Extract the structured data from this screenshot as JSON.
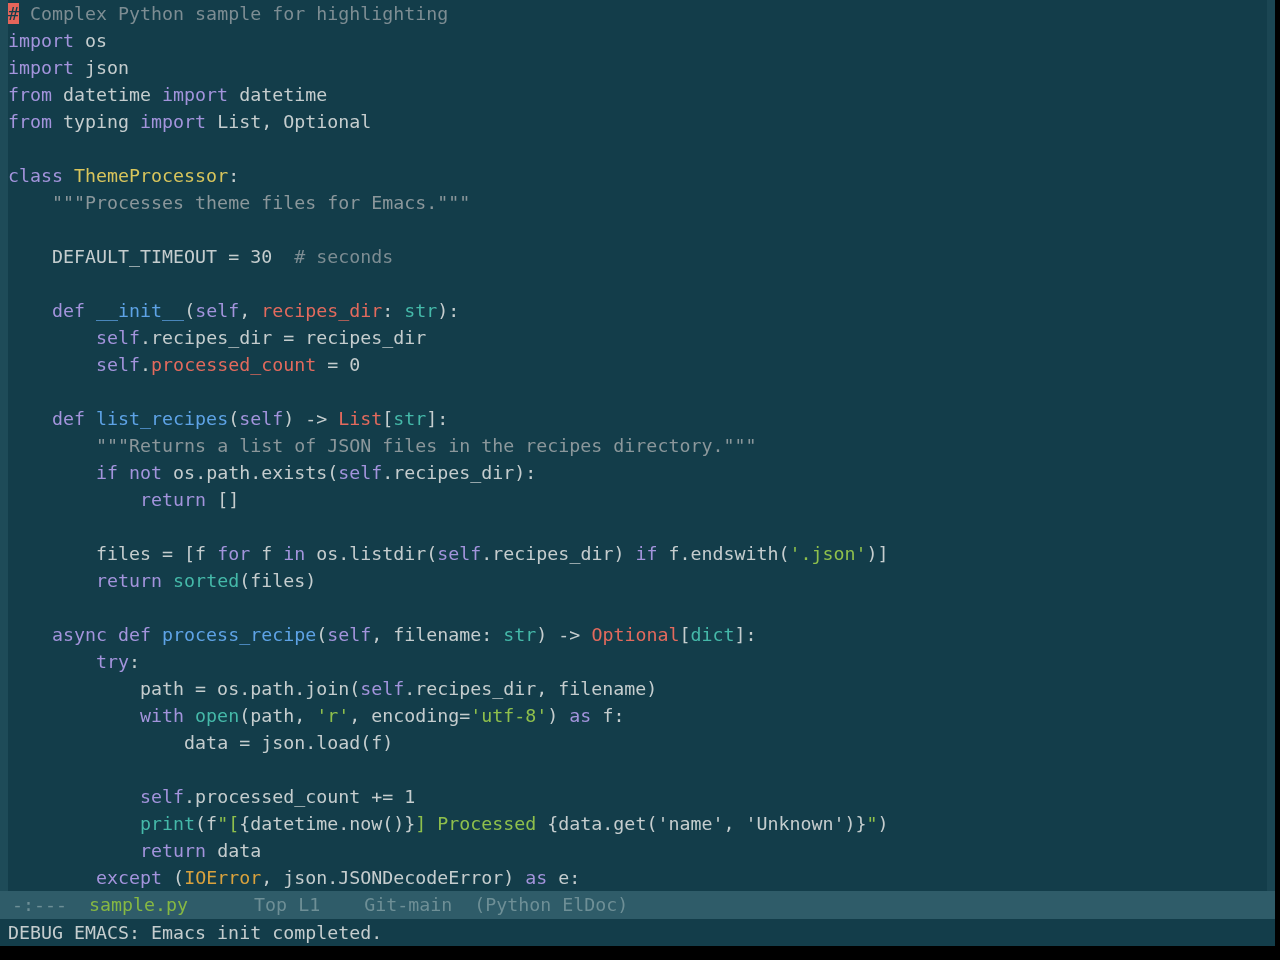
{
  "editor": {
    "lines": [
      {
        "kind": "code",
        "tokens": [
          {
            "text": "#",
            "kind": "cursor"
          },
          {
            "text": " Complex Python sample for highlighting",
            "kind": "comment"
          }
        ]
      },
      {
        "kind": "code",
        "tokens": [
          {
            "text": "import",
            "kind": "keyword"
          },
          {
            "text": " os",
            "kind": "plain"
          }
        ]
      },
      {
        "kind": "code",
        "tokens": [
          {
            "text": "import",
            "kind": "keyword"
          },
          {
            "text": " json",
            "kind": "plain"
          }
        ]
      },
      {
        "kind": "code",
        "tokens": [
          {
            "text": "from",
            "kind": "keyword"
          },
          {
            "text": " datetime ",
            "kind": "plain"
          },
          {
            "text": "import",
            "kind": "keyword"
          },
          {
            "text": " datetime",
            "kind": "plain"
          }
        ]
      },
      {
        "kind": "code",
        "tokens": [
          {
            "text": "from",
            "kind": "keyword"
          },
          {
            "text": " typing ",
            "kind": "plain"
          },
          {
            "text": "import",
            "kind": "keyword"
          },
          {
            "text": " List, Optional",
            "kind": "plain"
          }
        ]
      },
      {
        "kind": "blank"
      },
      {
        "kind": "code",
        "tokens": [
          {
            "text": "class ",
            "kind": "keyword"
          },
          {
            "text": "ThemeProcessor",
            "kind": "class_name"
          },
          {
            "text": ":",
            "kind": "plain"
          }
        ]
      },
      {
        "kind": "code",
        "tokens": [
          {
            "text": "    \"\"\"Processes theme files for Emacs.\"\"\"",
            "kind": "docstring"
          }
        ]
      },
      {
        "kind": "blank"
      },
      {
        "kind": "code",
        "tokens": [
          {
            "text": "    DEFAULT_TIMEOUT = 30  ",
            "kind": "plain"
          },
          {
            "text": "# seconds",
            "kind": "comment"
          }
        ]
      },
      {
        "kind": "blank"
      },
      {
        "kind": "code",
        "tokens": [
          {
            "text": "    def ",
            "kind": "keyword"
          },
          {
            "text": "__init__",
            "kind": "function"
          },
          {
            "text": "(",
            "kind": "plain"
          },
          {
            "text": "self",
            "kind": "keyword"
          },
          {
            "text": ", ",
            "kind": "plain"
          },
          {
            "text": "recipes_dir",
            "kind": "variable"
          },
          {
            "text": ": ",
            "kind": "plain"
          },
          {
            "text": "str",
            "kind": "builtin"
          },
          {
            "text": "):",
            "kind": "plain"
          }
        ]
      },
      {
        "kind": "code",
        "tokens": [
          {
            "text": "        self",
            "kind": "keyword"
          },
          {
            "text": ".recipes_dir = recipes_dir",
            "kind": "plain"
          }
        ]
      },
      {
        "kind": "code",
        "tokens": [
          {
            "text": "        self",
            "kind": "keyword"
          },
          {
            "text": ".",
            "kind": "plain"
          },
          {
            "text": "processed_count",
            "kind": "variable"
          },
          {
            "text": " = 0",
            "kind": "plain"
          }
        ]
      },
      {
        "kind": "blank"
      },
      {
        "kind": "code",
        "tokens": [
          {
            "text": "    def ",
            "kind": "keyword"
          },
          {
            "text": "list_recipes",
            "kind": "function"
          },
          {
            "text": "(",
            "kind": "plain"
          },
          {
            "text": "self",
            "kind": "keyword"
          },
          {
            "text": ") -> ",
            "kind": "plain"
          },
          {
            "text": "List",
            "kind": "annotation"
          },
          {
            "text": "[",
            "kind": "plain"
          },
          {
            "text": "str",
            "kind": "builtin"
          },
          {
            "text": "]:",
            "kind": "plain"
          }
        ]
      },
      {
        "kind": "code",
        "tokens": [
          {
            "text": "        \"\"\"Returns a list of JSON files in the recipes directory.\"\"\"",
            "kind": "docstring"
          }
        ]
      },
      {
        "kind": "code",
        "tokens": [
          {
            "text": "        if not",
            "kind": "keyword"
          },
          {
            "text": " os.path.exists(",
            "kind": "plain"
          },
          {
            "text": "self",
            "kind": "keyword"
          },
          {
            "text": ".recipes_dir):",
            "kind": "plain"
          }
        ]
      },
      {
        "kind": "code",
        "tokens": [
          {
            "text": "            return",
            "kind": "keyword"
          },
          {
            "text": " []",
            "kind": "plain"
          }
        ]
      },
      {
        "kind": "blank"
      },
      {
        "kind": "code",
        "tokens": [
          {
            "text": "        files = [f ",
            "kind": "plain"
          },
          {
            "text": "for",
            "kind": "keyword"
          },
          {
            "text": " f ",
            "kind": "plain"
          },
          {
            "text": "in",
            "kind": "keyword"
          },
          {
            "text": " os.listdir(",
            "kind": "plain"
          },
          {
            "text": "self",
            "kind": "keyword"
          },
          {
            "text": ".recipes_dir) ",
            "kind": "plain"
          },
          {
            "text": "if",
            "kind": "keyword"
          },
          {
            "text": " f.endswith(",
            "kind": "plain"
          },
          {
            "text": "'.json'",
            "kind": "string"
          },
          {
            "text": ")]",
            "kind": "plain"
          }
        ]
      },
      {
        "kind": "code",
        "tokens": [
          {
            "text": "        return ",
            "kind": "keyword"
          },
          {
            "text": "sorted",
            "kind": "builtin"
          },
          {
            "text": "(files)",
            "kind": "plain"
          }
        ]
      },
      {
        "kind": "blank"
      },
      {
        "kind": "code",
        "tokens": [
          {
            "text": "    async def ",
            "kind": "keyword"
          },
          {
            "text": "process_recipe",
            "kind": "function"
          },
          {
            "text": "(",
            "kind": "plain"
          },
          {
            "text": "self",
            "kind": "keyword"
          },
          {
            "text": ", filename: ",
            "kind": "plain"
          },
          {
            "text": "str",
            "kind": "builtin"
          },
          {
            "text": ") -> ",
            "kind": "plain"
          },
          {
            "text": "Optional",
            "kind": "annotation"
          },
          {
            "text": "[",
            "kind": "plain"
          },
          {
            "text": "dict",
            "kind": "builtin"
          },
          {
            "text": "]:",
            "kind": "plain"
          }
        ]
      },
      {
        "kind": "code",
        "tokens": [
          {
            "text": "        try",
            "kind": "keyword"
          },
          {
            "text": ":",
            "kind": "plain"
          }
        ]
      },
      {
        "kind": "code",
        "tokens": [
          {
            "text": "            path = os.path.join(",
            "kind": "plain"
          },
          {
            "text": "self",
            "kind": "keyword"
          },
          {
            "text": ".recipes_dir, filename)",
            "kind": "plain"
          }
        ]
      },
      {
        "kind": "code",
        "tokens": [
          {
            "text": "            with ",
            "kind": "keyword"
          },
          {
            "text": "open",
            "kind": "builtin"
          },
          {
            "text": "(path, ",
            "kind": "plain"
          },
          {
            "text": "'r'",
            "kind": "string"
          },
          {
            "text": ", encoding=",
            "kind": "plain"
          },
          {
            "text": "'utf-8'",
            "kind": "string"
          },
          {
            "text": ") ",
            "kind": "plain"
          },
          {
            "text": "as",
            "kind": "keyword"
          },
          {
            "text": " f:",
            "kind": "plain"
          }
        ]
      },
      {
        "kind": "code",
        "tokens": [
          {
            "text": "                data = json.load(f)",
            "kind": "plain"
          }
        ]
      },
      {
        "kind": "blank"
      },
      {
        "kind": "code",
        "tokens": [
          {
            "text": "            self",
            "kind": "keyword"
          },
          {
            "text": ".processed_count += 1",
            "kind": "plain"
          }
        ]
      },
      {
        "kind": "code",
        "tokens": [
          {
            "text": "            print",
            "kind": "builtin"
          },
          {
            "text": "(f",
            "kind": "plain"
          },
          {
            "text": "\"[",
            "kind": "string"
          },
          {
            "text": "{datetime.now()}",
            "kind": "plain"
          },
          {
            "text": "] Processed ",
            "kind": "string"
          },
          {
            "text": "{data.get('name', 'Unknown')}",
            "kind": "plain"
          },
          {
            "text": "\"",
            "kind": "string"
          },
          {
            "text": ")",
            "kind": "plain"
          }
        ]
      },
      {
        "kind": "code",
        "tokens": [
          {
            "text": "            return",
            "kind": "keyword"
          },
          {
            "text": " data",
            "kind": "plain"
          }
        ]
      },
      {
        "kind": "code",
        "tokens": [
          {
            "text": "        except",
            "kind": "keyword"
          },
          {
            "text": " (",
            "kind": "plain"
          },
          {
            "text": "IOError",
            "kind": "exception"
          },
          {
            "text": ", json.JSONDecodeError) ",
            "kind": "plain"
          },
          {
            "text": "as",
            "kind": "keyword"
          },
          {
            "text": " e:",
            "kind": "plain"
          }
        ]
      }
    ]
  },
  "mode_line": {
    "segments": [
      {
        "text": "-:---",
        "kind": "status"
      },
      {
        "text": "sample.py",
        "kind": "buffer"
      },
      {
        "text": "Top L1",
        "kind": "position"
      },
      {
        "text": "Git-main",
        "kind": "vc"
      },
      {
        "text": "(Python ElDoc)",
        "kind": "modes"
      }
    ]
  },
  "echo_area": {
    "message": "DEBUG EMACS: Emacs init completed."
  }
}
